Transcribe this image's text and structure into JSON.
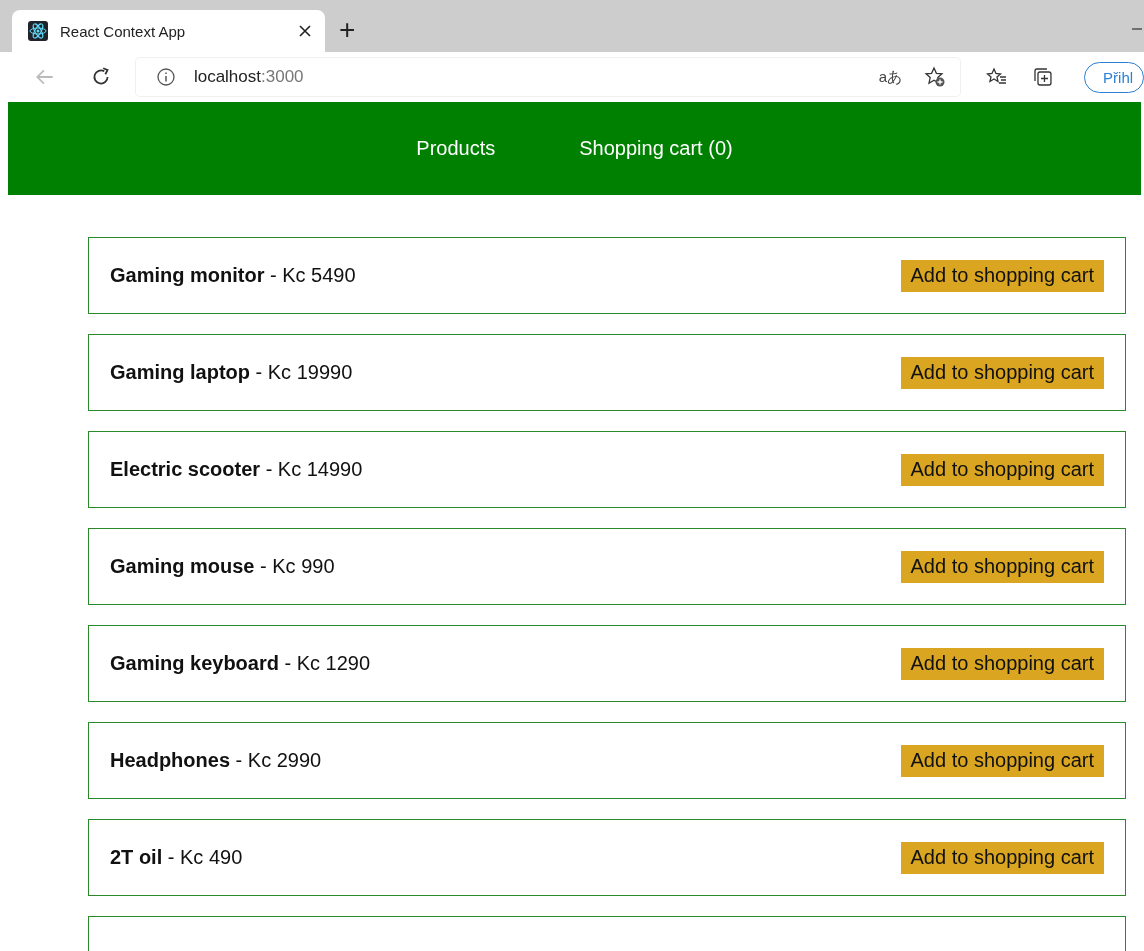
{
  "browser": {
    "tab": {
      "title": "React Context App"
    },
    "new_tab": "+",
    "address": {
      "host": "localhost",
      "port": ":3000"
    },
    "translate": "aあ",
    "profile": "Přihl"
  },
  "nav": {
    "items": [
      {
        "label": "Products"
      },
      {
        "label": "Shopping cart (0)"
      }
    ]
  },
  "products": [
    {
      "text": "**Gaming monitor** - Kc 5490",
      "button": "Add to shopping cart"
    },
    {
      "text": "**Gaming laptop** - Kc 19990",
      "button": "Add to shopping cart"
    },
    {
      "text": "**Electric scooter** - Kc 14990",
      "button": "Add to shopping cart"
    },
    {
      "text": "**Gaming mouse** - Kc 990",
      "button": "Add to shopping cart"
    },
    {
      "text": "**Gaming keyboard** - Kc 1290",
      "button": "Add to shopping cart"
    },
    {
      "text": "**Headphones** - Kc 2990",
      "button": "Add to shopping cart"
    },
    {
      "text": "**2T oil** - Kc 490",
      "button": "Add to shopping cart"
    }
  ]
}
